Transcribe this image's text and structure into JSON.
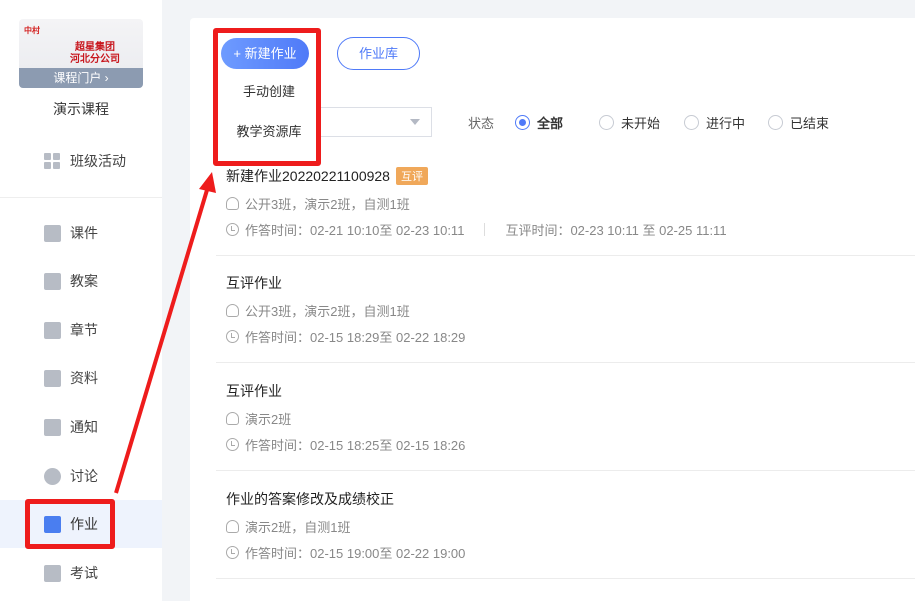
{
  "sidebar": {
    "logo_mark": "中村",
    "logo_line1": "超星集团",
    "logo_line2": "河北分公司",
    "portal_label": "课程门户 ›",
    "course_name": "演示课程",
    "top_item": {
      "label": "班级活动",
      "icon": "grid-icon"
    },
    "items": [
      {
        "label": "课件",
        "icon": "ppt-icon"
      },
      {
        "label": "教案",
        "icon": "doc-icon"
      },
      {
        "label": "章节",
        "icon": "list-icon"
      },
      {
        "label": "资料",
        "icon": "folder-icon"
      },
      {
        "label": "通知",
        "icon": "speaker-icon"
      },
      {
        "label": "讨论",
        "icon": "chat-icon"
      },
      {
        "label": "作业",
        "icon": "homework-icon",
        "active": true
      },
      {
        "label": "考试",
        "icon": "exam-icon"
      }
    ]
  },
  "toolbar": {
    "new_button": "+ 新建作业",
    "library_button": "作业库"
  },
  "new_menu": {
    "items": [
      "手动创建",
      "教学资源库"
    ]
  },
  "filter": {
    "status_label": "状态",
    "options": [
      "全部",
      "未开始",
      "进行中",
      "已结束"
    ],
    "selected": "全部"
  },
  "homework": [
    {
      "title": "新建作业20220221100928",
      "badge": "互评",
      "classes": "公开3班，演示2班，自测1班",
      "answer_time": "作答时间：02-21 10:10至 02-23 10:11",
      "review_time": "互评时间：02-23 10:11 至 02-25 11:11"
    },
    {
      "title": "互评作业",
      "classes": "公开3班，演示2班，自测1班",
      "answer_time": "作答时间：02-15 18:29至 02-22 18:29"
    },
    {
      "title": "互评作业",
      "classes": "演示2班",
      "answer_time": "作答时间：02-15 18:25至 02-15 18:26"
    },
    {
      "title": "作业的答案修改及成绩校正",
      "classes": "演示2班，自测1班",
      "answer_time": "作答时间：02-15 19:00至 02-22 19:00"
    }
  ],
  "colors": {
    "accent": "#4f7af8",
    "highlight": "#ee1c1c",
    "badge": "#f0a85a"
  }
}
